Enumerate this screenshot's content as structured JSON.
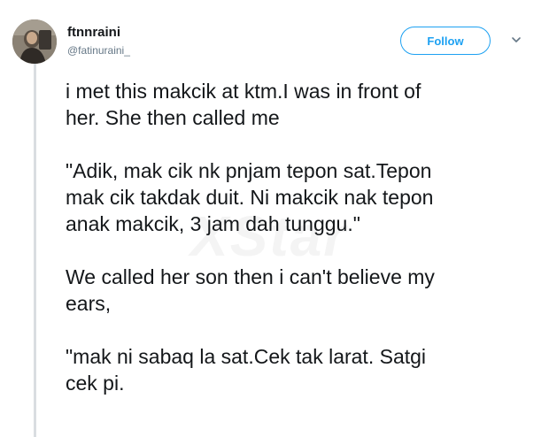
{
  "tweet": {
    "author_name": "ftnnraini",
    "author_handle": "@fatinuraini_",
    "follow_label": "Follow",
    "paragraphs": [
      "i met this makcik at ktm.I was in front of\nher. She then called me",
      "\"Adik, mak cik nk pnjam tepon sat.Tepon\nmak cik takdak duit. Ni makcik nak tepon\nanak makcik, 3 jam dah tunggu.\"",
      "We called her son then i can't believe my\nears,",
      "\"mak ni sabaq la sat.Cek tak larat. Satgi\ncek pi."
    ]
  },
  "watermark": "XStar",
  "colors": {
    "accent": "#1da1f2",
    "text": "#14171a",
    "muted": "#657786",
    "rule": "#d9dde1"
  },
  "icons": {
    "menu": "chevron-down-icon",
    "avatar": "profile-avatar"
  }
}
